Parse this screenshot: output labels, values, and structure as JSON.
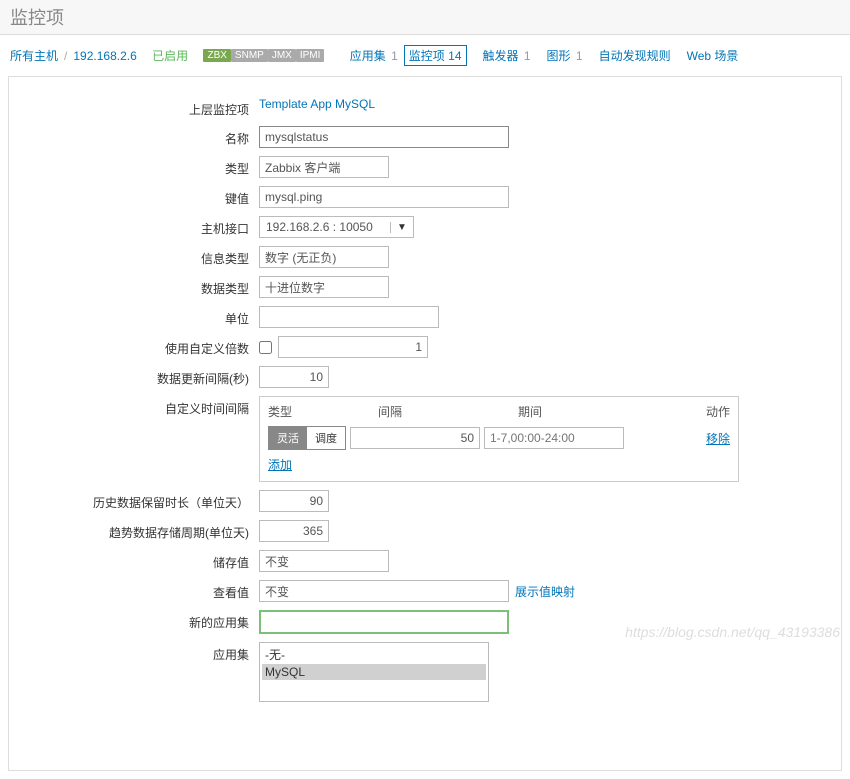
{
  "page_title": "监控项",
  "breadcrumb": {
    "all_hosts": "所有主机",
    "host_ip": "192.168.2.6",
    "enabled": "已启用"
  },
  "proto_badges": {
    "zbx": "ZBX",
    "snmp": "SNMP",
    "jmx": "JMX",
    "ipmi": "IPMI"
  },
  "tabs": {
    "apps": {
      "label": "应用集",
      "count": "1"
    },
    "items": {
      "label": "监控项",
      "count": "14"
    },
    "triggers": {
      "label": "触发器",
      "count": "1"
    },
    "graphs": {
      "label": "图形",
      "count": "1"
    },
    "discovery": {
      "label": "自动发现规则"
    },
    "web": {
      "label": "Web 场景"
    }
  },
  "form": {
    "parent_label": "上层监控项",
    "parent_value": "Template App MySQL",
    "name_label": "名称",
    "name_value": "mysqlstatus",
    "type_label": "类型",
    "type_value": "Zabbix 客户端",
    "key_label": "键值",
    "key_value": "mysql.ping",
    "hostif_label": "主机接口",
    "hostif_value": "192.168.2.6 : 10050",
    "info_label": "信息类型",
    "info_value": "数字 (无正负)",
    "data_label": "数据类型",
    "data_value": "十进位数字",
    "unit_label": "单位",
    "unit_value": "",
    "mult_label": "使用自定义倍数",
    "mult_value": "1",
    "interval_label": "数据更新间隔(秒)",
    "interval_value": "10",
    "custom_interval_label": "自定义时间间隔",
    "intervals_header": {
      "type": "类型",
      "interval": "间隔",
      "period": "期间",
      "action": "动作"
    },
    "interval_row": {
      "toggle_flex": "灵活",
      "toggle_sched": "调度",
      "int_val": "50",
      "period_placeholder": "1-7,00:00-24:00",
      "remove": "移除"
    },
    "add_interval": "添加",
    "history_label": "历史数据保留时长（单位天）",
    "history_value": "90",
    "trend_label": "趋势数据存储周期(单位天)",
    "trend_value": "365",
    "store_label": "储存值",
    "store_value": "不变",
    "view_label": "查看值",
    "view_value": "不变",
    "valuemap_link": "展示值映射",
    "newapp_label": "新的应用集",
    "newapp_value": "",
    "apps_label": "应用集",
    "apps_options": {
      "none": "-无-",
      "mysql": "MySQL"
    }
  },
  "watermark": "https://blog.csdn.net/qq_43193386"
}
